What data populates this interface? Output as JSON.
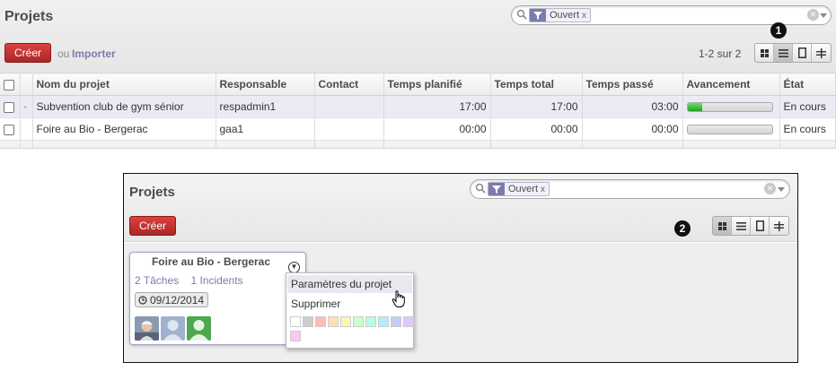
{
  "top": {
    "title": "Projets",
    "search": {
      "facet_label": "Ouvert",
      "facet_remove": "x"
    },
    "create_label": "Créer",
    "or_label": "ou",
    "import_label": "Importer",
    "pager": "1-2 sur 2",
    "badge": "1",
    "columns": [
      "Nom du projet",
      "Responsable",
      "Contact",
      "Temps planifié",
      "Temps total",
      "Temps passé",
      "Avancement",
      "État"
    ],
    "rows": [
      {
        "name": "Subvention club de gym sénior",
        "manager": "respadmin1",
        "contact": "",
        "planned": "17:00",
        "total": "17:00",
        "spent": "03:00",
        "progress": 0.18,
        "state": "En cours"
      },
      {
        "name": "Foire au Bio - Bergerac",
        "manager": "gaa1",
        "contact": "",
        "planned": "00:00",
        "total": "00:00",
        "spent": "00:00",
        "progress": 0,
        "state": "En cours"
      }
    ]
  },
  "bottom": {
    "title": "Projets",
    "search": {
      "facet_label": "Ouvert",
      "facet_remove": "x"
    },
    "create_label": "Créer",
    "badge": "2",
    "card": {
      "title": "Foire au Bio - Bergerac",
      "tasks_link": "2 Tâches",
      "issues_link": "1 Incidents",
      "date": "09/12/2014"
    },
    "menu": {
      "settings": "Paramètres du projet",
      "delete": "Supprimer",
      "swatch_colors": [
        "#ffffff",
        "#cccccc",
        "#ffbbbb",
        "#ffe0b3",
        "#fff5b3",
        "#ccffcc",
        "#b3ffe6",
        "#b3ecff",
        "#c6ccff",
        "#e0c6ff",
        "#ffc6f0"
      ]
    }
  },
  "colors": {
    "accent": "#7c7bad",
    "create_button": "#c43737",
    "progress_fill": "#2cb52c"
  }
}
